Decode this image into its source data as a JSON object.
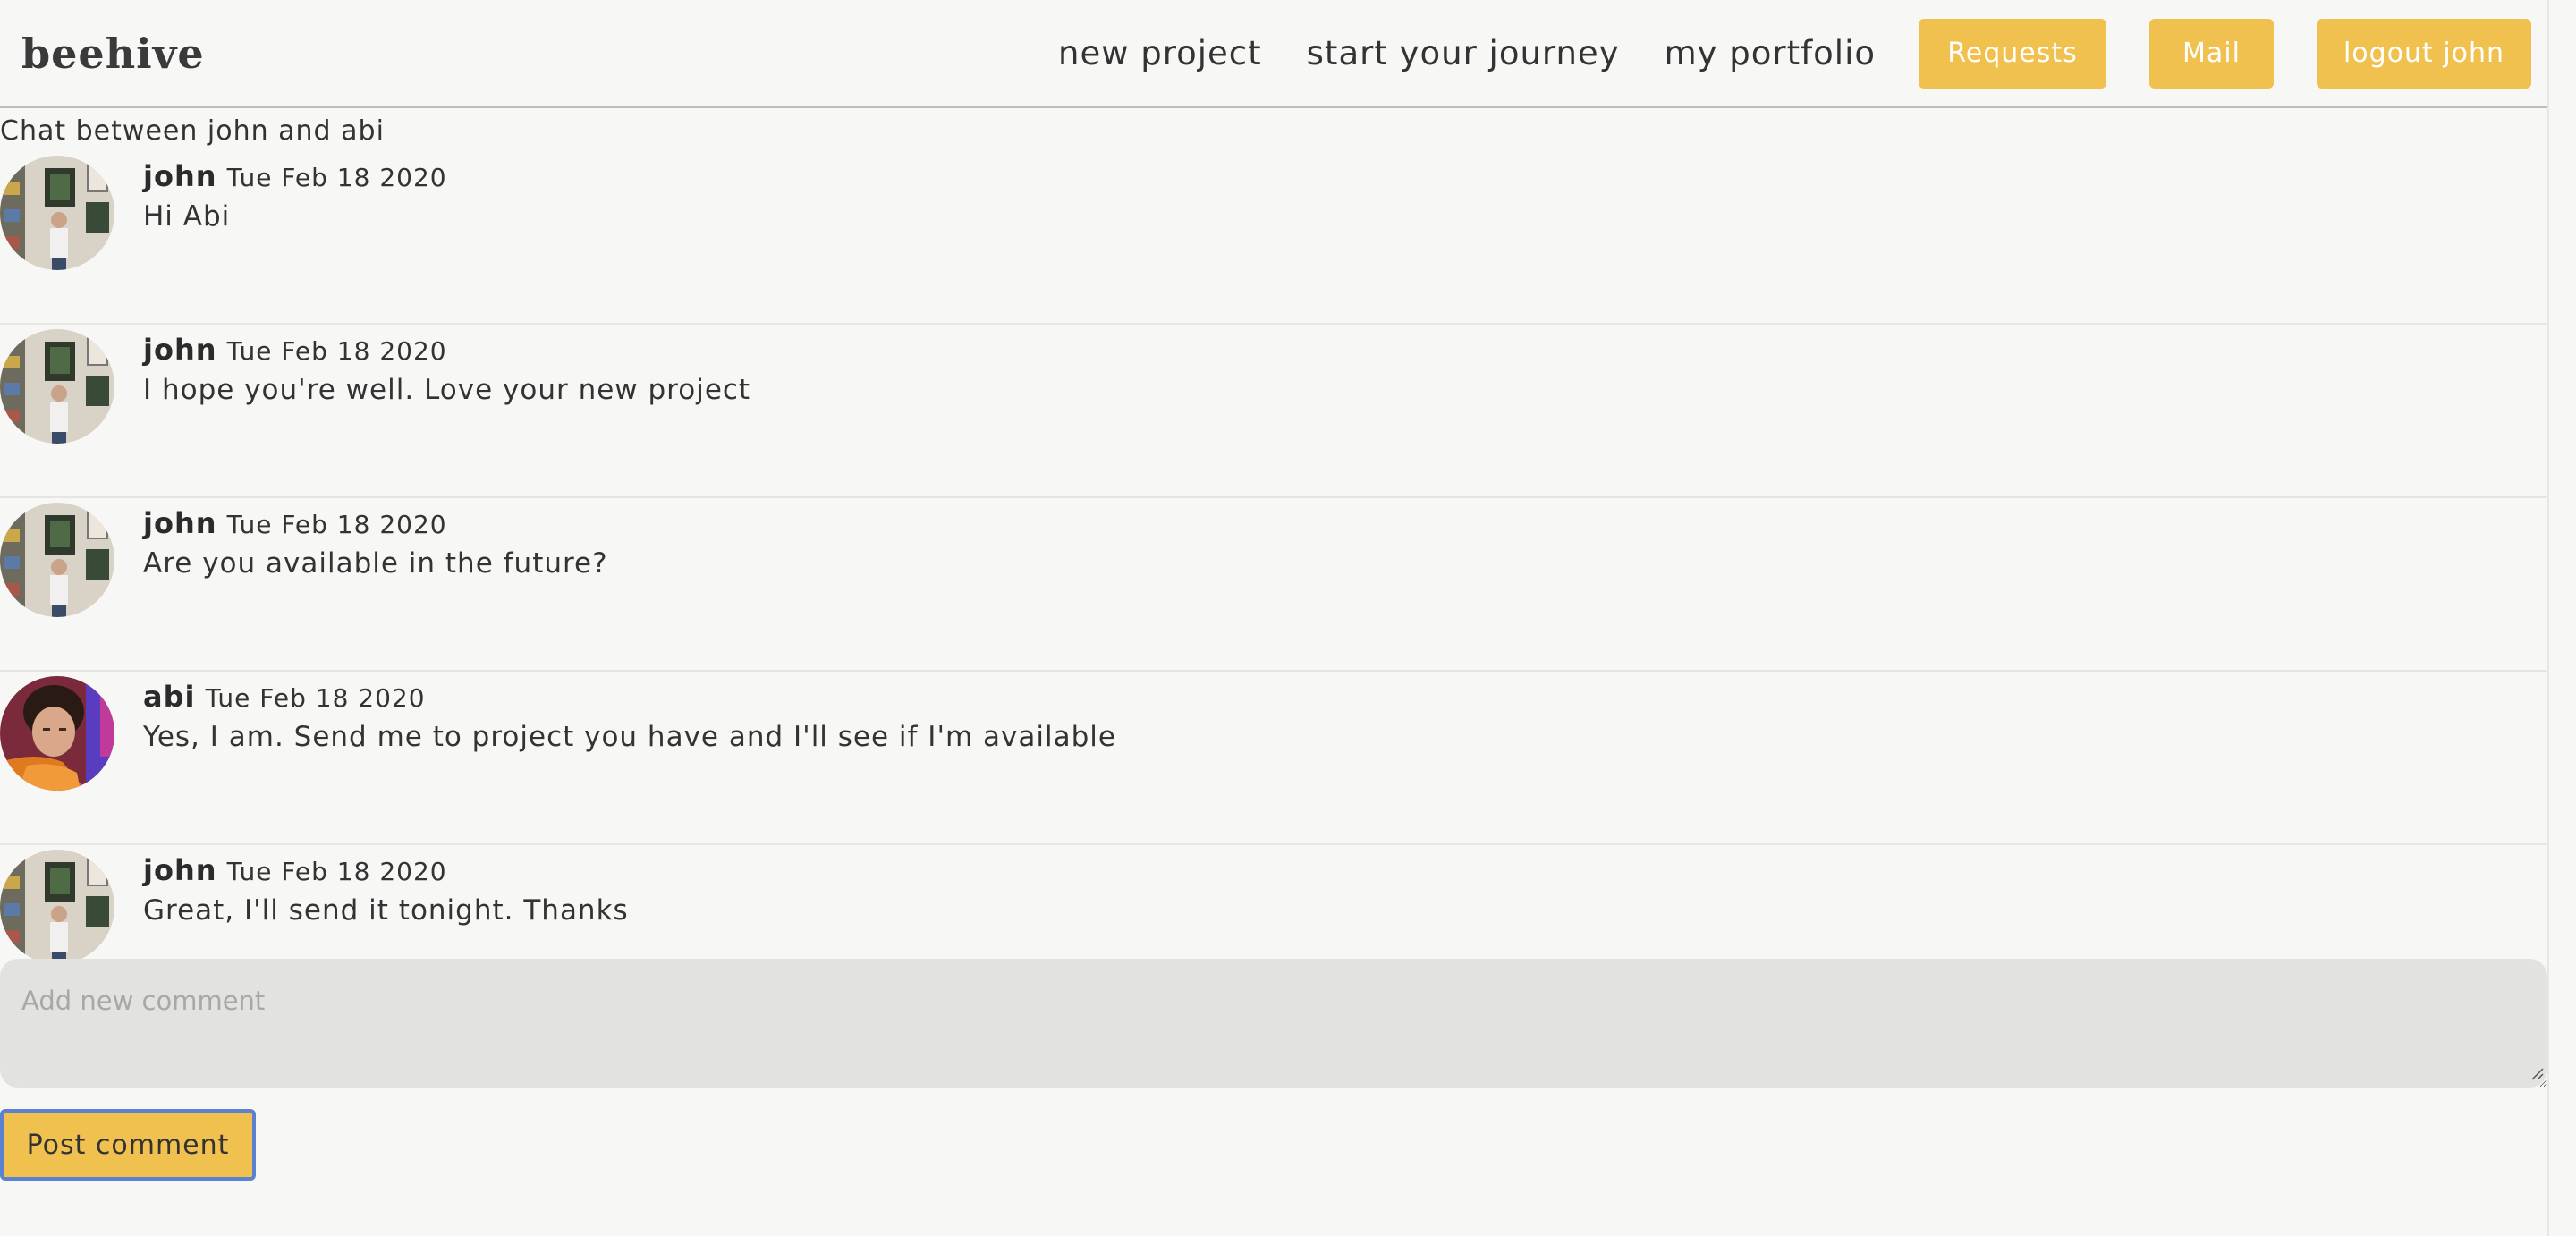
{
  "header": {
    "logo": "beehive",
    "nav": [
      "new project",
      "start your journey",
      "my portfolio"
    ],
    "buttons": {
      "requests": "Requests",
      "mail": "Mail",
      "logout": "logout john"
    }
  },
  "chat": {
    "title": "Chat between john and abi",
    "messages": [
      {
        "author": "john",
        "date": "Tue Feb 18 2020",
        "text": "Hi Abi"
      },
      {
        "author": "john",
        "date": "Tue Feb 18 2020",
        "text": "I hope you're well. Love your new project"
      },
      {
        "author": "john",
        "date": "Tue Feb 18 2020",
        "text": "Are you available in the future?"
      },
      {
        "author": "abi",
        "date": "Tue Feb 18 2020",
        "text": "Yes, I am. Send me to project you have and I'll see if I'm available"
      },
      {
        "author": "john",
        "date": "Tue Feb 18 2020",
        "text": "Great, I'll send it tonight. Thanks"
      }
    ]
  },
  "comment": {
    "placeholder": "Add new comment",
    "value": "",
    "submit_label": "Post comment"
  },
  "colors": {
    "accent": "#f0c14f",
    "background": "#f7f7f5",
    "input_bg": "#e2e2e0",
    "focus_ring": "#5a82d1"
  }
}
